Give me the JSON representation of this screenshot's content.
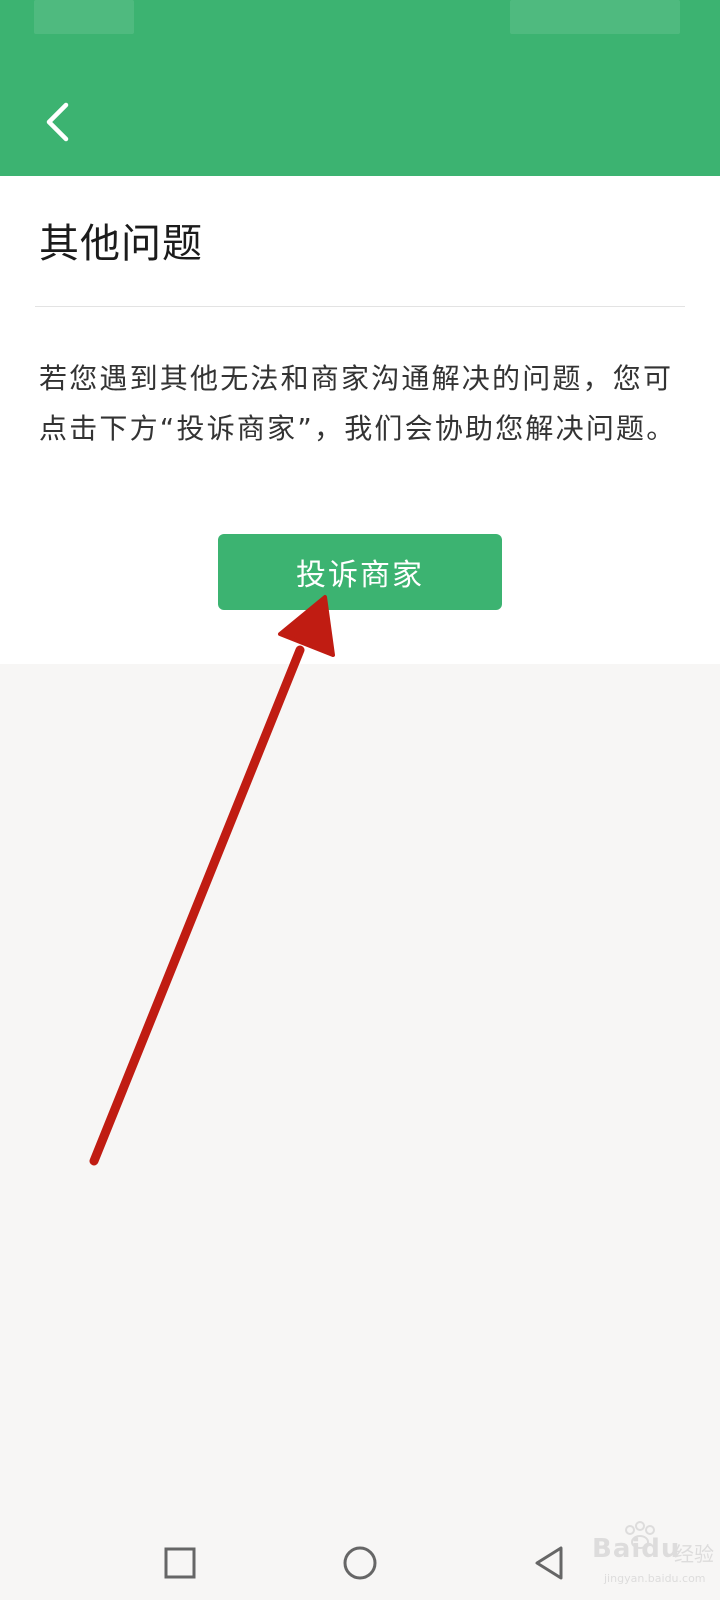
{
  "header": {
    "back_icon": "chevron-left-icon",
    "background_color": "#3cb371"
  },
  "page": {
    "title": "其他问题",
    "description": "若您遇到其他无法和商家沟通解决的问题，您可点击下方“投诉商家”，我们会协助您解决问题。"
  },
  "actions": {
    "complain_button_label": "投诉商家",
    "button_color": "#3cb371"
  },
  "annotation": {
    "arrow_color": "#c01c12",
    "arrow_target": "complain-button"
  },
  "navigation": {
    "recent_apps_icon": "square-icon",
    "home_icon": "circle-icon",
    "back_icon": "triangle-back-icon"
  },
  "watermark": {
    "brand": "Baidu",
    "text": "经验",
    "url": "jingyan.baidu.com"
  }
}
